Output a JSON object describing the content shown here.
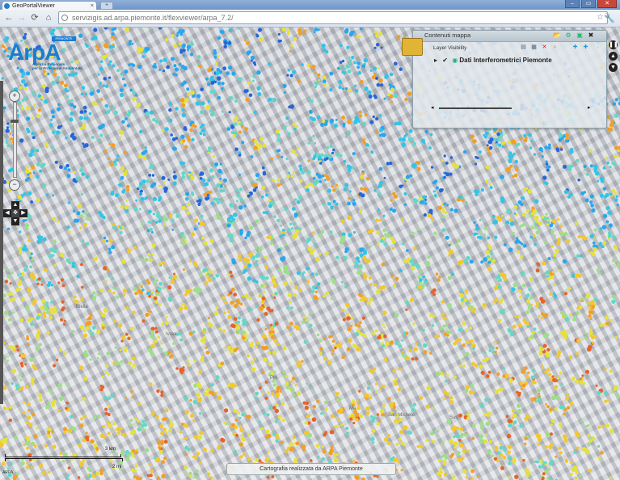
{
  "browser": {
    "tab_title": "GeoPortalViewer",
    "tab_close": "×",
    "new_tab": "+",
    "url": "servizigis.ad.arpa.piemonte.it/flexviewer/arpa_7.2/",
    "window_buttons": [
      "–",
      "▭",
      "✕"
    ]
  },
  "logo": {
    "text": "ArpA",
    "region": "PIEMONTE",
    "subtitle_lines": [
      "Agenzia Regionale",
      "per la Protezione Ambientale"
    ]
  },
  "map_labels": [
    "Biella",
    "Ivrea",
    "San Michele",
    "Sud",
    "Ma",
    "Pin"
  ],
  "panel": {
    "title": "Contenuti mappa",
    "layer_visibility_label": "Layer Visibility",
    "layer": {
      "name": "Dati Interferometrici Piemonte",
      "checked": true,
      "expand_glyph": "▸",
      "check_glyph": "✔"
    },
    "slider_left": "◂",
    "slider_right": "▸"
  },
  "zoom": {
    "plus": "+",
    "minus": "−"
  },
  "scale": {
    "top_label": "3 km",
    "bottom_label": "2 mi"
  },
  "credit": "Cartografia realizzata da ARPA Piemonte",
  "corner_text": "ARPA",
  "colors": {
    "accent": "#1c7dd0",
    "points": [
      "#2aa6ef",
      "#34c4e6",
      "#62d8c7",
      "#9be087",
      "#e6e13c",
      "#f3c82e",
      "#f29f26",
      "#e6642b",
      "#2866d8"
    ]
  }
}
